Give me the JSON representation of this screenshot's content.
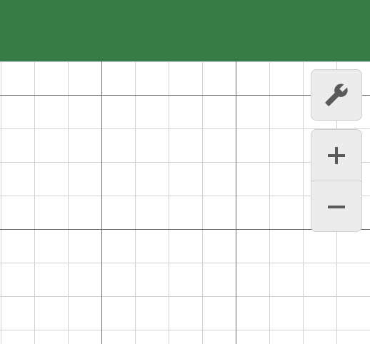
{
  "header": {
    "background_color": "#377b46"
  },
  "graph": {
    "minor_grid_color": "#d0d0d0",
    "major_grid_color": "#6b6b6b"
  },
  "toolbar": {
    "settings_icon": "wrench-icon",
    "zoom_in_icon": "plus-icon",
    "zoom_out_icon": "minus-icon",
    "icon_color": "#5a5a5a",
    "button_background": "#ececec"
  }
}
